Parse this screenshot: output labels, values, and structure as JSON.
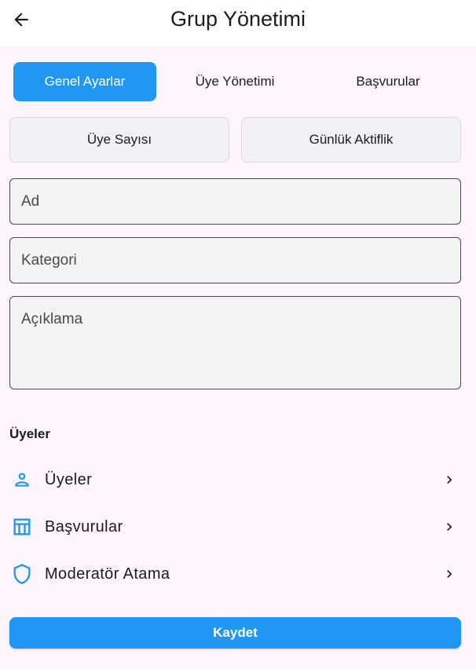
{
  "appbar": {
    "title": "Grup Yönetimi",
    "back_icon": "arrow-left-icon"
  },
  "tabs": [
    {
      "label": "Genel Ayarlar",
      "active": true
    },
    {
      "label": "Üye Yönetimi",
      "active": false
    },
    {
      "label": "Başvurular",
      "active": false
    }
  ],
  "stats": {
    "member_count_label": "Üye Sayısı",
    "daily_activity_label": "Günlük Aktiflik"
  },
  "form": {
    "name_placeholder": "Ad",
    "category_placeholder": "Kategori",
    "description_placeholder": "Açıklama"
  },
  "members_section": {
    "title": "Üyeler",
    "items": [
      {
        "label": "Üyeler",
        "icon": "person-icon"
      },
      {
        "label": "Başvurular",
        "icon": "table-icon"
      },
      {
        "label": "Moderatör Atama",
        "icon": "shield-icon"
      }
    ]
  },
  "actions": {
    "save_label": "Kaydet"
  },
  "colors": {
    "accent": "#2196f3",
    "background": "#fcf6fc"
  }
}
